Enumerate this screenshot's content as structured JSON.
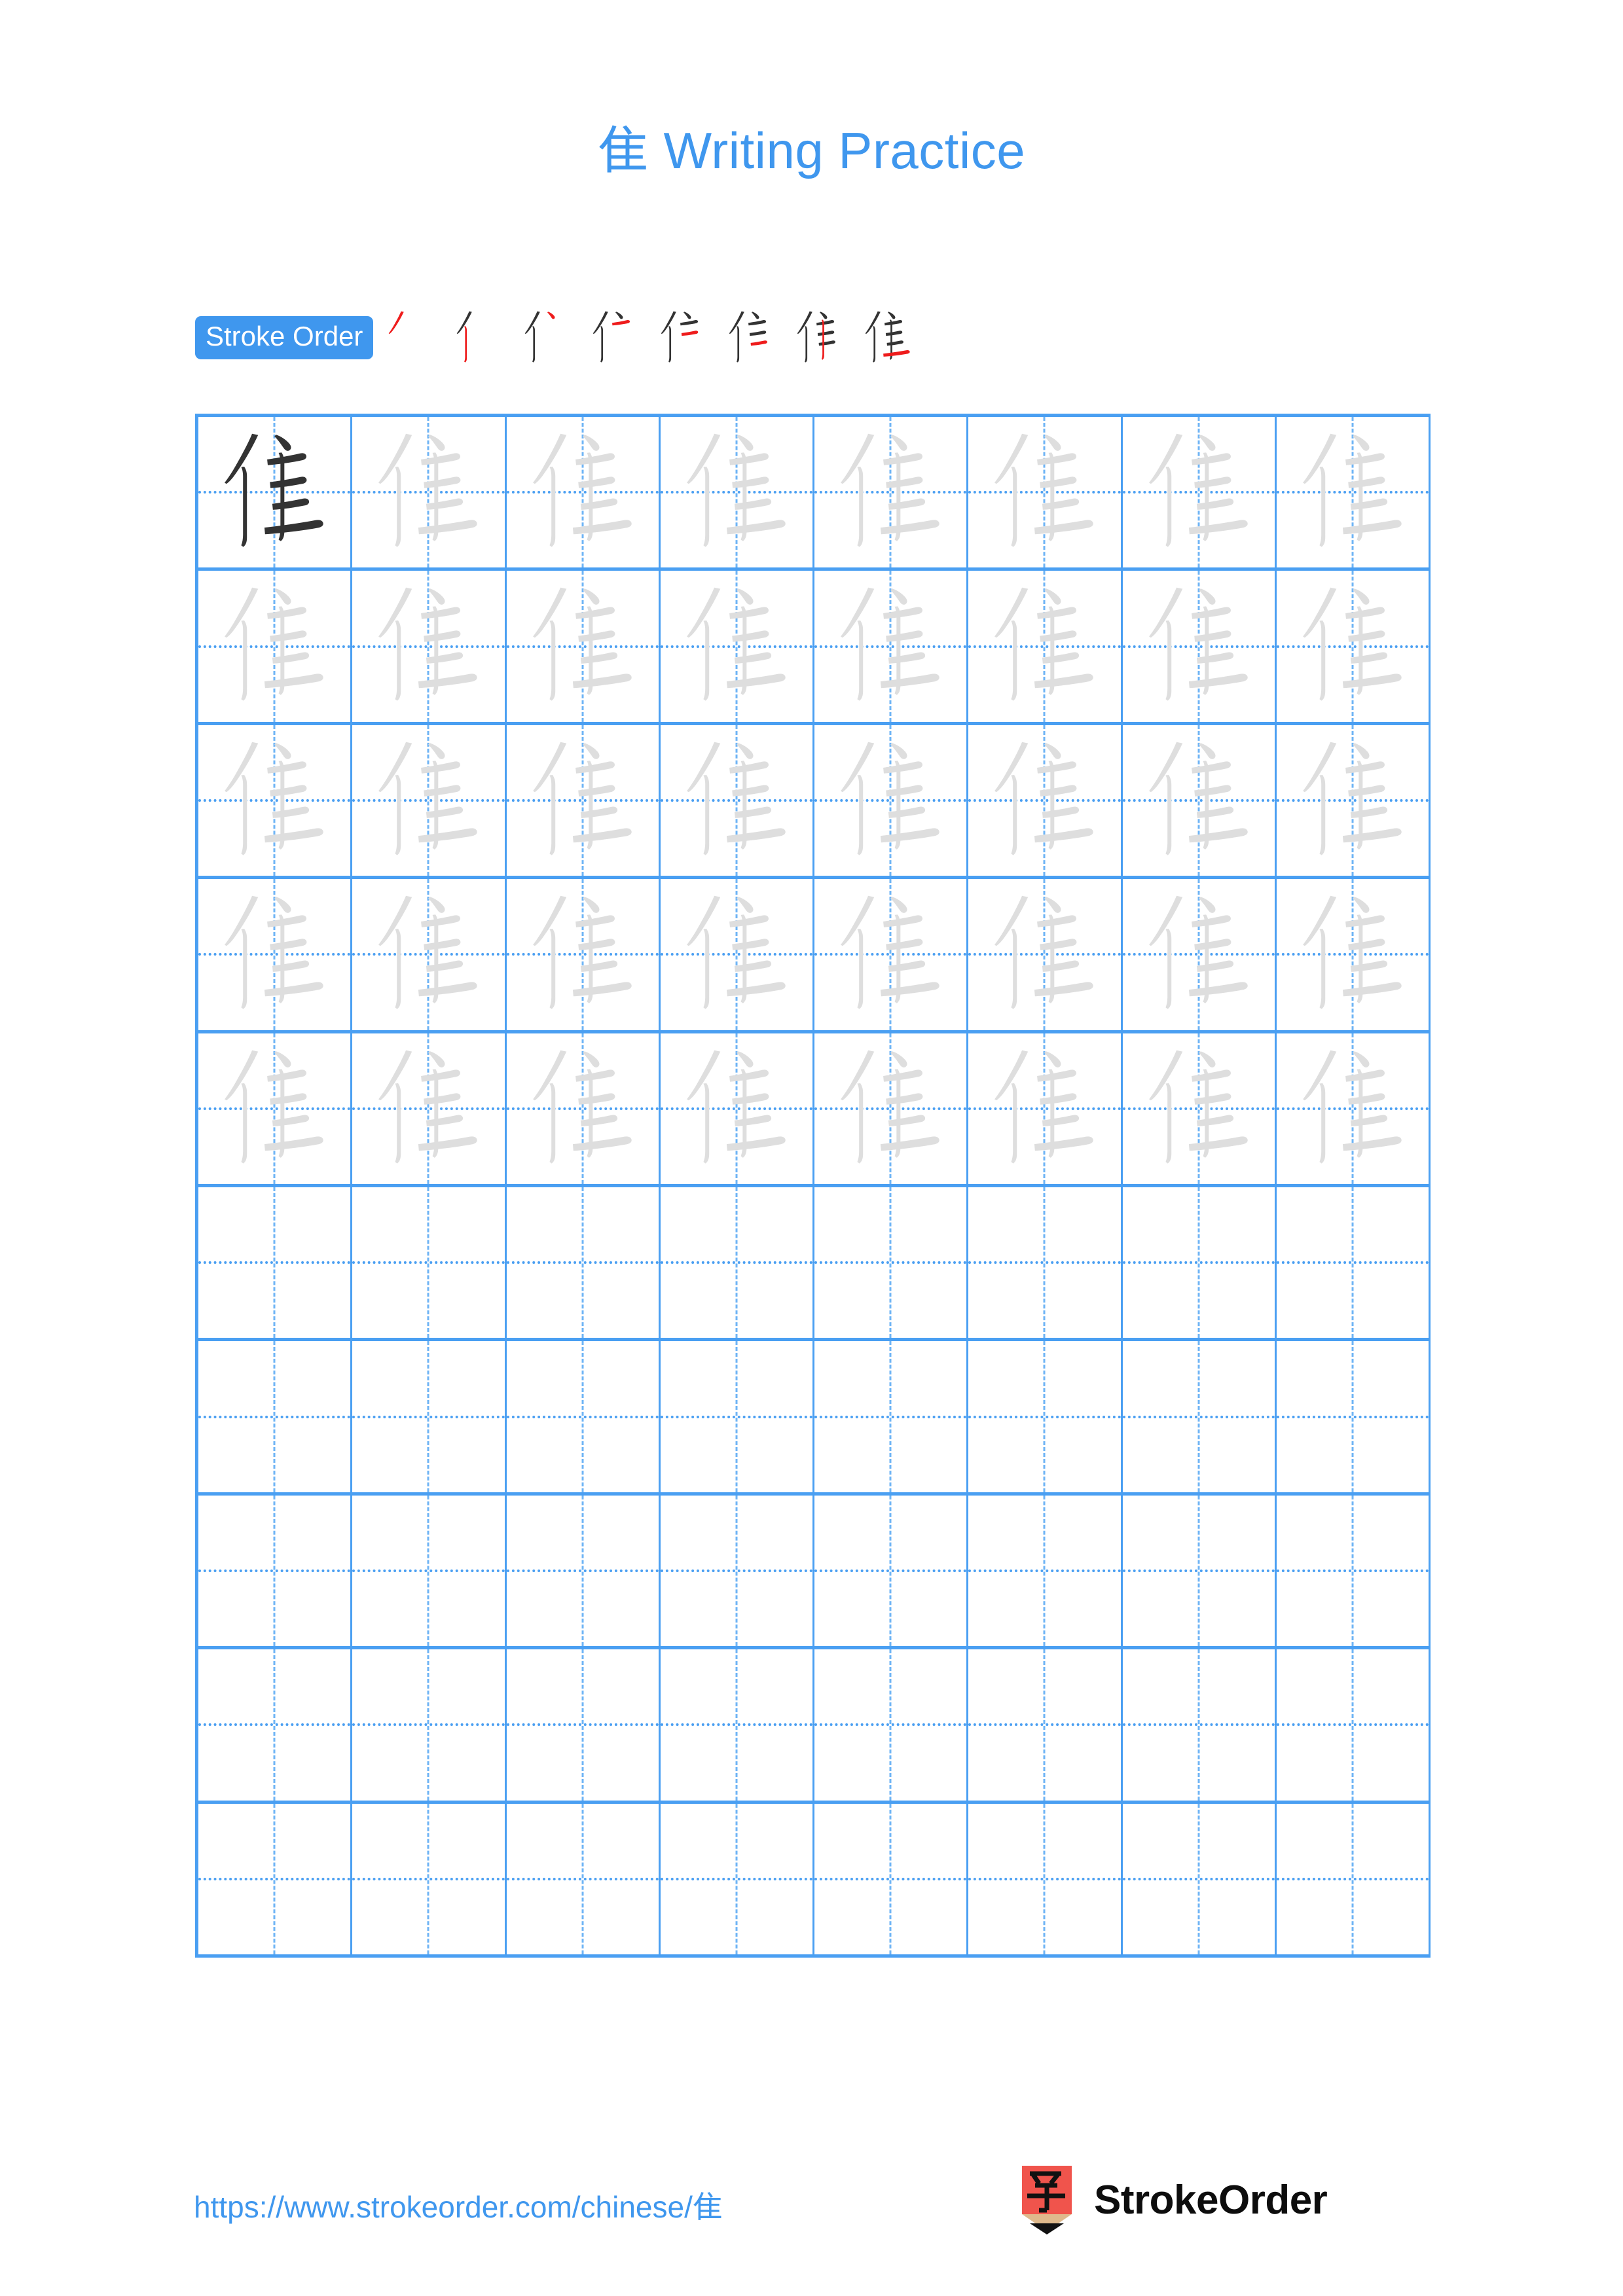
{
  "document": {
    "character": "隹",
    "title": "隹 Writing Practice",
    "title_suffix": " Writing Practice",
    "accent_color": "#3f97ee",
    "grid_line_color": "#4a9ff2",
    "guide_line_color": "#6fb4f5",
    "traced_char_color": "#333333",
    "ghost_char_color": "#dedede",
    "new_stroke_color": "#ee1c1c"
  },
  "stroke_order": {
    "badge_label": "Stroke Order",
    "total_strokes": 8,
    "steps": [
      {
        "index": 1,
        "strokes_drawn": 1,
        "new_stroke": 1,
        "name": "stroke-step-1"
      },
      {
        "index": 2,
        "strokes_drawn": 2,
        "new_stroke": 2,
        "name": "stroke-step-2"
      },
      {
        "index": 3,
        "strokes_drawn": 3,
        "new_stroke": 3,
        "name": "stroke-step-3"
      },
      {
        "index": 4,
        "strokes_drawn": 4,
        "new_stroke": 4,
        "name": "stroke-step-4"
      },
      {
        "index": 5,
        "strokes_drawn": 5,
        "new_stroke": 5,
        "name": "stroke-step-5"
      },
      {
        "index": 6,
        "strokes_drawn": 6,
        "new_stroke": 6,
        "name": "stroke-step-6"
      },
      {
        "index": 7,
        "strokes_drawn": 7,
        "new_stroke": 7,
        "name": "stroke-step-7"
      },
      {
        "index": 8,
        "strokes_drawn": 8,
        "new_stroke": 8,
        "name": "stroke-step-8"
      }
    ]
  },
  "practice_grid": {
    "columns": 8,
    "rows": 10,
    "rows_data": [
      {
        "row": 1,
        "cells": [
          "dark",
          "ghost",
          "ghost",
          "ghost",
          "ghost",
          "ghost",
          "ghost",
          "ghost"
        ]
      },
      {
        "row": 2,
        "cells": [
          "ghost",
          "ghost",
          "ghost",
          "ghost",
          "ghost",
          "ghost",
          "ghost",
          "ghost"
        ]
      },
      {
        "row": 3,
        "cells": [
          "ghost",
          "ghost",
          "ghost",
          "ghost",
          "ghost",
          "ghost",
          "ghost",
          "ghost"
        ]
      },
      {
        "row": 4,
        "cells": [
          "ghost",
          "ghost",
          "ghost",
          "ghost",
          "ghost",
          "ghost",
          "ghost",
          "ghost"
        ]
      },
      {
        "row": 5,
        "cells": [
          "ghost",
          "ghost",
          "ghost",
          "ghost",
          "ghost",
          "ghost",
          "ghost",
          "ghost"
        ]
      },
      {
        "row": 6,
        "cells": [
          "empty",
          "empty",
          "empty",
          "empty",
          "empty",
          "empty",
          "empty",
          "empty"
        ]
      },
      {
        "row": 7,
        "cells": [
          "empty",
          "empty",
          "empty",
          "empty",
          "empty",
          "empty",
          "empty",
          "empty"
        ]
      },
      {
        "row": 8,
        "cells": [
          "empty",
          "empty",
          "empty",
          "empty",
          "empty",
          "empty",
          "empty",
          "empty"
        ]
      },
      {
        "row": 9,
        "cells": [
          "empty",
          "empty",
          "empty",
          "empty",
          "empty",
          "empty",
          "empty",
          "empty"
        ]
      },
      {
        "row": 10,
        "cells": [
          "empty",
          "empty",
          "empty",
          "empty",
          "empty",
          "empty",
          "empty",
          "empty"
        ]
      }
    ]
  },
  "footer": {
    "url": "https://www.strokeorder.com/chinese/隹",
    "brand_name": "StrokeOrder",
    "logo": {
      "icon_char": "字",
      "body_color": "#f0544c",
      "wood_color": "#dfb98c",
      "tip_color": "#111111"
    }
  }
}
